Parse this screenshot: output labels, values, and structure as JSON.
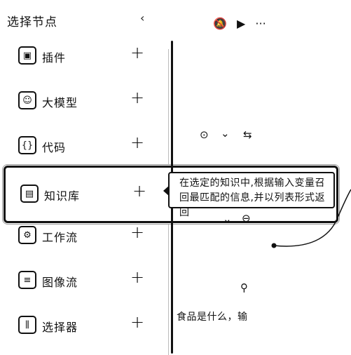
{
  "panel": {
    "title": "选择节点",
    "collapse_icon": "chevron-left-icon",
    "add_label": "+",
    "items": [
      {
        "label": "插件",
        "icon": "cube-icon",
        "glyph": "▣"
      },
      {
        "label": "大模型",
        "icon": "robot-face-icon",
        "glyph": "☺"
      },
      {
        "label": "代码",
        "icon": "code-icon",
        "glyph": "{}"
      },
      {
        "label": "知识库",
        "icon": "book-icon",
        "glyph": "▤"
      },
      {
        "label": "工作流",
        "icon": "flow-icon",
        "glyph": "⚙"
      },
      {
        "label": "图像流",
        "icon": "image-flow-icon",
        "glyph": "≡"
      },
      {
        "label": "选择器",
        "icon": "branch-icon",
        "glyph": "⫼"
      }
    ],
    "selected_index": 3
  },
  "tooltip": {
    "text": "在选定的知识中,根据输入变量召回最匹配的信息,并以列表形式返回"
  },
  "canvas": {
    "top_icons": [
      "bell-off-icon",
      "play-icon",
      "more-icon"
    ],
    "top_glyphs": [
      "🔕",
      "▶",
      "···"
    ],
    "mid_controls": [
      "⊙",
      "⌄",
      "⇆"
    ],
    "small_controls": [
      "⌄",
      "⊖"
    ],
    "user_icon_glyph": "⚲",
    "snippet_text": "食品是什么，输"
  }
}
